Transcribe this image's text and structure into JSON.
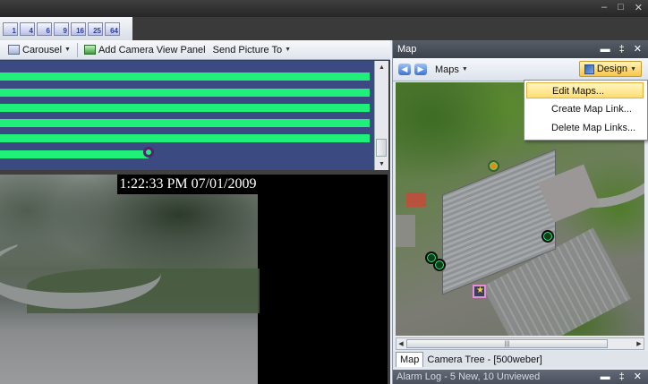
{
  "window": {
    "controls": [
      "–",
      "□",
      "✕"
    ]
  },
  "layout_buttons": [
    "1",
    "4",
    "6",
    "9",
    "16",
    "25",
    "64"
  ],
  "left_toolbar": {
    "carousel_label": "Carousel",
    "add_panel_label": "Add Camera View Panel",
    "send_picture_label": "Send Picture To"
  },
  "timeline": {
    "bar_count": 6,
    "colors": {
      "background": "#3b4a80",
      "bar": "#1ef07a",
      "marker": "#5a1f70"
    }
  },
  "video": {
    "timestamp": "1:22:33 PM 07/01/2009"
  },
  "map_panel": {
    "title": "Map",
    "title_controls": [
      "▬",
      "‡",
      "✕"
    ],
    "nav_back_icon": "◀",
    "nav_forward_icon": "▶",
    "maps_label": "Maps",
    "design_label": "Design",
    "design_menu": [
      "Edit Maps...",
      "Create Map Link...",
      "Delete Map Links..."
    ],
    "tabs": [
      "Map",
      "Camera Tree - [500weber]"
    ]
  },
  "alarm_log": {
    "title": "Alarm Log - 5 New, 10 Unviewed",
    "controls": [
      "▬",
      "‡",
      "✕"
    ]
  }
}
